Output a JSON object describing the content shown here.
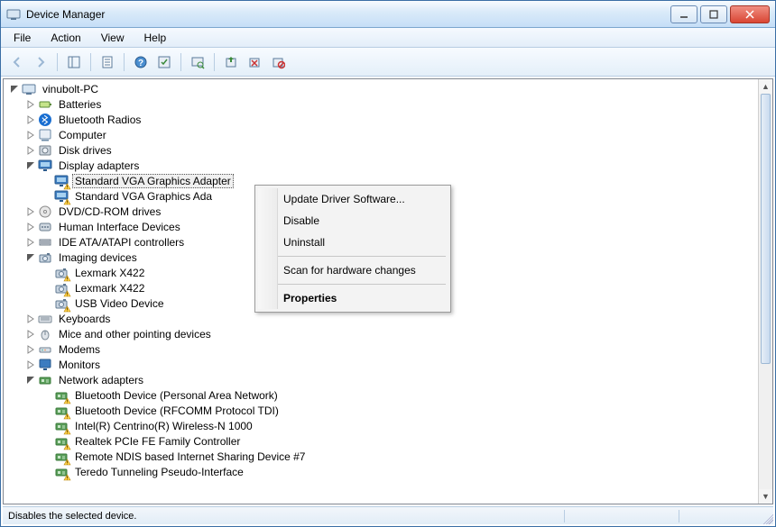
{
  "window": {
    "title": "Device Manager"
  },
  "menubar": {
    "items": [
      "File",
      "Action",
      "View",
      "Help"
    ]
  },
  "toolbar": {
    "buttons": [
      {
        "name": "back-button",
        "glyph": "arrow-left",
        "disabled": true
      },
      {
        "name": "forward-button",
        "glyph": "arrow-right",
        "disabled": true
      },
      {
        "sep": true
      },
      {
        "name": "show-hide-console-tree-button",
        "glyph": "console-tree"
      },
      {
        "sep": true
      },
      {
        "name": "properties-button",
        "glyph": "properties"
      },
      {
        "sep": true
      },
      {
        "name": "help-button",
        "glyph": "help"
      },
      {
        "name": "action-button",
        "glyph": "action"
      },
      {
        "sep": true
      },
      {
        "name": "scan-button",
        "glyph": "scan"
      },
      {
        "sep": true
      },
      {
        "name": "update-driver-button",
        "glyph": "update-driver"
      },
      {
        "name": "uninstall-button",
        "glyph": "uninstall"
      },
      {
        "name": "disable-button",
        "glyph": "disable"
      }
    ]
  },
  "tree": [
    {
      "d": 0,
      "t": "open",
      "icon": "computer",
      "label": "vinubolt-PC"
    },
    {
      "d": 1,
      "t": "closed",
      "icon": "battery",
      "label": "Batteries"
    },
    {
      "d": 1,
      "t": "closed",
      "icon": "bluetooth",
      "label": "Bluetooth Radios"
    },
    {
      "d": 1,
      "t": "closed",
      "icon": "pc",
      "label": "Computer"
    },
    {
      "d": 1,
      "t": "closed",
      "icon": "disk",
      "label": "Disk drives"
    },
    {
      "d": 1,
      "t": "open",
      "icon": "display",
      "label": "Display adapters"
    },
    {
      "d": 2,
      "t": "none",
      "icon": "display",
      "label": "Standard VGA Graphics Adapter",
      "selected": true,
      "warn": true
    },
    {
      "d": 2,
      "t": "none",
      "icon": "display",
      "label": "Standard VGA Graphics Adapter",
      "warn": true,
      "clip": true
    },
    {
      "d": 1,
      "t": "closed",
      "icon": "dvd",
      "label": "DVD/CD-ROM drives"
    },
    {
      "d": 1,
      "t": "closed",
      "icon": "hid",
      "label": "Human Interface Devices"
    },
    {
      "d": 1,
      "t": "closed",
      "icon": "ide",
      "label": "IDE ATA/ATAPI controllers"
    },
    {
      "d": 1,
      "t": "open",
      "icon": "imaging",
      "label": "Imaging devices"
    },
    {
      "d": 2,
      "t": "none",
      "icon": "imaging",
      "label": "Lexmark X422",
      "warn": true
    },
    {
      "d": 2,
      "t": "none",
      "icon": "imaging",
      "label": "Lexmark X422",
      "warn": true
    },
    {
      "d": 2,
      "t": "none",
      "icon": "imaging",
      "label": "USB Video Device",
      "warn": true
    },
    {
      "d": 1,
      "t": "closed",
      "icon": "keyboard",
      "label": "Keyboards"
    },
    {
      "d": 1,
      "t": "closed",
      "icon": "mouse",
      "label": "Mice and other pointing devices"
    },
    {
      "d": 1,
      "t": "closed",
      "icon": "modem",
      "label": "Modems"
    },
    {
      "d": 1,
      "t": "closed",
      "icon": "monitor",
      "label": "Monitors"
    },
    {
      "d": 1,
      "t": "open",
      "icon": "network",
      "label": "Network adapters"
    },
    {
      "d": 2,
      "t": "none",
      "icon": "network",
      "label": "Bluetooth Device (Personal Area Network)",
      "warn": true
    },
    {
      "d": 2,
      "t": "none",
      "icon": "network",
      "label": "Bluetooth Device (RFCOMM Protocol TDI)",
      "warn": true
    },
    {
      "d": 2,
      "t": "none",
      "icon": "network",
      "label": "Intel(R) Centrino(R) Wireless-N 1000",
      "warn": true
    },
    {
      "d": 2,
      "t": "none",
      "icon": "network",
      "label": "Realtek PCIe FE Family Controller",
      "warn": true
    },
    {
      "d": 2,
      "t": "none",
      "icon": "network",
      "label": "Remote NDIS based Internet Sharing Device #7",
      "warn": true
    },
    {
      "d": 2,
      "t": "none",
      "icon": "network",
      "label": "Teredo Tunneling Pseudo-Interface",
      "warn": true
    }
  ],
  "contextmenu": {
    "items": [
      {
        "label": "Update Driver Software...",
        "name": "ctx-update-driver"
      },
      {
        "label": "Disable",
        "name": "ctx-disable"
      },
      {
        "label": "Uninstall",
        "name": "ctx-uninstall"
      },
      {
        "sep": true
      },
      {
        "label": "Scan for hardware changes",
        "name": "ctx-scan"
      },
      {
        "sep": true
      },
      {
        "label": "Properties",
        "name": "ctx-properties",
        "bold": true
      }
    ]
  },
  "statusbar": {
    "text": "Disables the selected device."
  }
}
